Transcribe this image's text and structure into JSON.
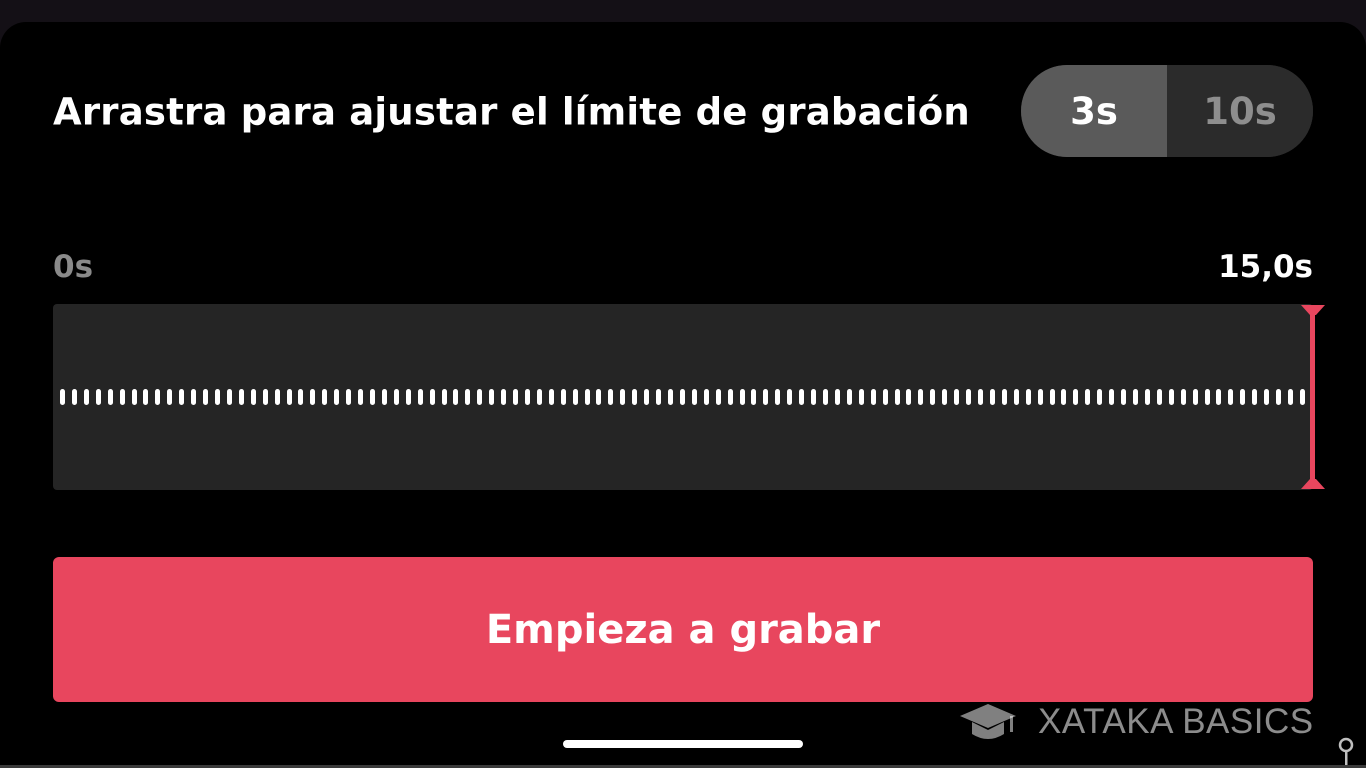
{
  "header": {
    "title": "Arrastra para ajustar el límite de grabación"
  },
  "countdown_toggle": {
    "options": [
      {
        "label": "3s",
        "selected": true
      },
      {
        "label": "10s",
        "selected": false
      }
    ]
  },
  "timeline": {
    "start_label": "0s",
    "end_label": "15,0s",
    "limit_fraction": 1.0
  },
  "actions": {
    "record_label": "Empieza a grabar"
  },
  "watermark": {
    "text": "XATAKA BASICS",
    "icon": "graduation-cap-icon"
  },
  "colors": {
    "accent": "#e8465e",
    "track": "#252525",
    "toggle_active": "#5a5a5a",
    "toggle_inactive": "#2b2b2b"
  }
}
